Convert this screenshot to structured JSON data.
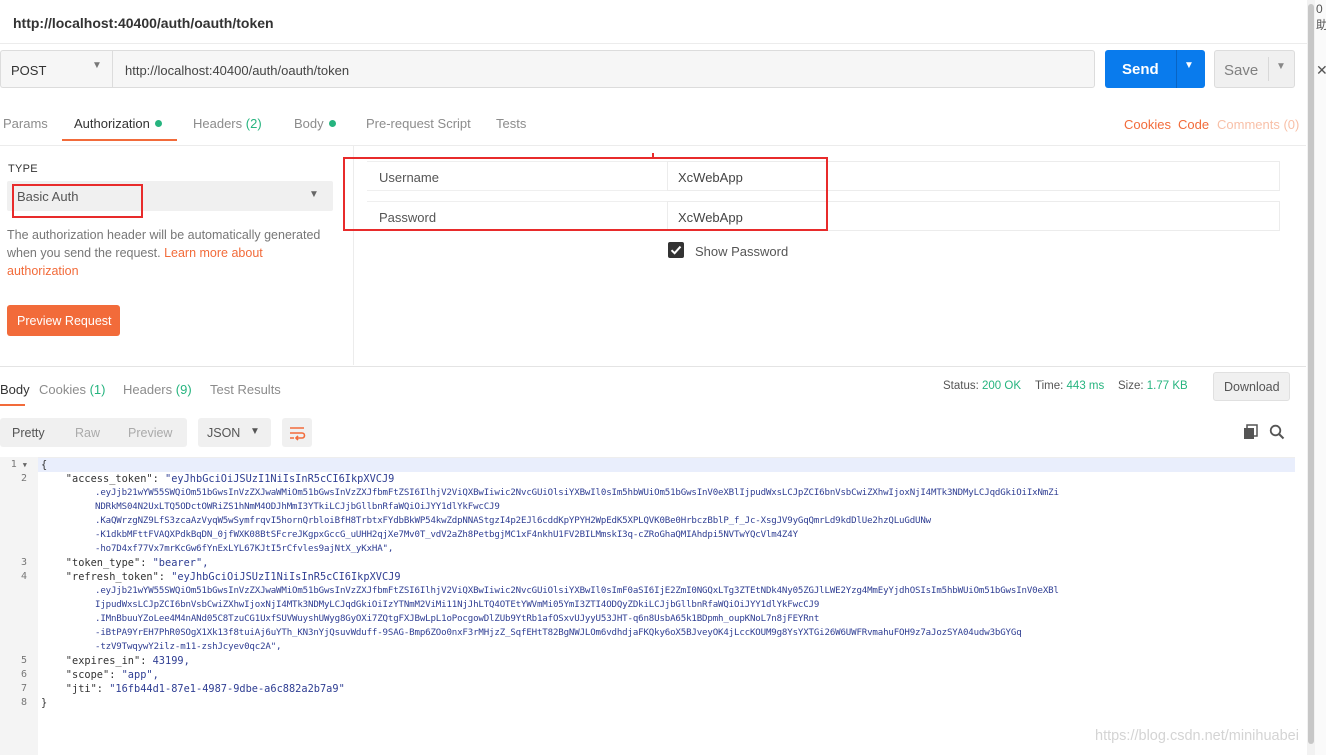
{
  "window": {
    "title": "http://localhost:40400/auth/oauth/token"
  },
  "request": {
    "method": "POST",
    "url": "http://localhost:40400/auth/oauth/token",
    "send_label": "Send",
    "save_label": "Save"
  },
  "tabs": {
    "params": "Params",
    "authorization": "Authorization",
    "headers": "Headers",
    "headers_count": "(2)",
    "body": "Body",
    "pre_request": "Pre-request Script",
    "tests": "Tests",
    "cookies": "Cookies",
    "code": "Code",
    "comments": "Comments (0)"
  },
  "auth": {
    "type_label": "TYPE",
    "type_value": "Basic Auth",
    "description": "The authorization header will be automatically generated when you send the request.",
    "learn_more": "Learn more about authorization",
    "preview_button": "Preview Request",
    "username_label": "Username",
    "username_value": "XcWebApp",
    "password_label": "Password",
    "password_value": "XcWebApp",
    "show_password_label": "Show Password",
    "show_password_checked": true
  },
  "response": {
    "tabs": {
      "body": "Body",
      "cookies": "Cookies",
      "cookies_count": "(1)",
      "headers": "Headers",
      "headers_count": "(9)",
      "test_results": "Test Results"
    },
    "status_label": "Status:",
    "status_value": "200 OK",
    "time_label": "Time:",
    "time_value": "443 ms",
    "size_label": "Size:",
    "size_value": "1.77 KB",
    "download_label": "Download",
    "view_modes": [
      "Pretty",
      "Raw",
      "Preview"
    ],
    "format": "JSON"
  },
  "code": {
    "line_numbers": [
      "1",
      "2",
      "3",
      "4",
      "5",
      "6",
      "7",
      "8"
    ],
    "open_brace": "{",
    "close_brace": "}",
    "access_token": {
      "key": "    \"access_token\": ",
      "value_start": "\"eyJhbGciOiJSUzI1NiIsInR5cCI6IkpXVCJ9",
      "cont": [
        ".eyJjb21wYW55SWQiOm51bGwsInVzZXJwaWMiOm51bGwsInVzZXJfbmFtZSI6IlhjV2ViQXBwIiwic2NvcGUiOlsiYXBwIl0sIm5hbWUiOm51bGwsInV0eXBlIjpudWxsLCJpZCI6bnVsbCwiZXhwIjoxNjI4MTk3NDMyLCJqdGkiOiIxNmZi",
        "NDRkMS04N2UxLTQ5ODctOWRiZS1hNmM4ODJhMmI3YTkiLCJjbGllbnRfaWQiOiJYY1dlYkFwcCJ9",
        ".KaQWrzgNZ9LfS3zcaAzVyqW5wSymfrqvI5hornQrbloiBfH8TrbtxFYdbBkWP54kwZdpNNAStgzI4p2EJl6cddKpYPYH2WpEdK5XPLQVK0Be0HrbczBblP_f_Jc-XsgJV9yGqQmrLd9kdDlUe2hzQLuGdUNw",
        "-K1dkbMFttFVAQXPdkBqDN_0jfWXK08BtSFcreJKgpxGccG_uUHH2qjXe7Mv0T_vdV2aZh8PetbgjMC1xF4nkhU1FV2BILMmskI3q-cZRoGhaQMIAhdpi5NVTwYQcVlm4Z4Y",
        "-ho7D4xf77Vx7mrKcGw6fYnExLYL67KJtI5rCfvles9ajNtX_yKxHA\","
      ]
    },
    "token_type": {
      "key": "    \"token_type\": ",
      "value": "\"bearer\","
    },
    "refresh_token": {
      "key": "    \"refresh_token\": ",
      "value_start": "\"eyJhbGciOiJSUzI1NiIsInR5cCI6IkpXVCJ9",
      "cont": [
        ".eyJjb21wYW55SWQiOm51bGwsInVzZXJwaWMiOm51bGwsInVzZXJfbmFtZSI6IlhjV2ViQXBwIiwic2NvcGUiOlsiYXBwIl0sImF0aSI6IjE2ZmI0NGQxLTg3ZTEtNDk4Ny05ZGJlLWE2Yzg4MmEyYjdhOSIsIm5hbWUiOm51bGwsInV0eXBl",
        "IjpudWxsLCJpZCI6bnVsbCwiZXhwIjoxNjI4MTk3NDMyLCJqdGkiOiIzYTNmM2ViMi11NjJhLTQ4OTEtYWVmMi05YmI3ZTI4ODQyZDkiLCJjbGllbnRfaWQiOiJYY1dlYkFwcCJ9",
        ".IMnBbuuYZoLee4M4nANd05C8TzuCG1UxfSUVWuyshUWyg8GyOXi7ZQtgFXJBwLpL1oPocgowDlZUb9YtRb1afOSxvUJyyU53JHT-q6n8UsbA65k1BDpmh_oupKNoL7n8jFEYRnt",
        "-iBtPA9YrEH7PhR0SOgX1Xk13f8tuiAj6uYTh_KN3nYjQsuvWduff-9SAG-Bmp6ZOo0nxF3rMHjzZ_SqfEHtT82BgNWJLOm6vdhdjaFKQky6oX5BJveyOK4jLccKOUM9g8YsYXTGi26W6UWFRvmahuFOH9z7aJozSYA04udw3bGYGq",
        "-tzV9TwqywY2ilz-m11-zshJcyev0qc2A\","
      ]
    },
    "expires_in": {
      "key": "    \"expires_in\": ",
      "value": "43199,"
    },
    "scope": {
      "key": "    \"scope\": ",
      "value": "\"app\","
    },
    "jti": {
      "key": "    \"jti\": ",
      "value": "\"16fb44d1-87e1-4987-9dbe-a6c882a2b7a9\""
    }
  },
  "watermark": "https://blog.csdn.net/minihuabei",
  "edge": {
    "glyph": "0",
    "glyph2": "助",
    "close": "✕"
  },
  "colors": {
    "accent_orange": "#f26b3a",
    "send_blue": "#097bed",
    "status_green": "#26b47f",
    "annotation_red": "#e82b2b"
  }
}
